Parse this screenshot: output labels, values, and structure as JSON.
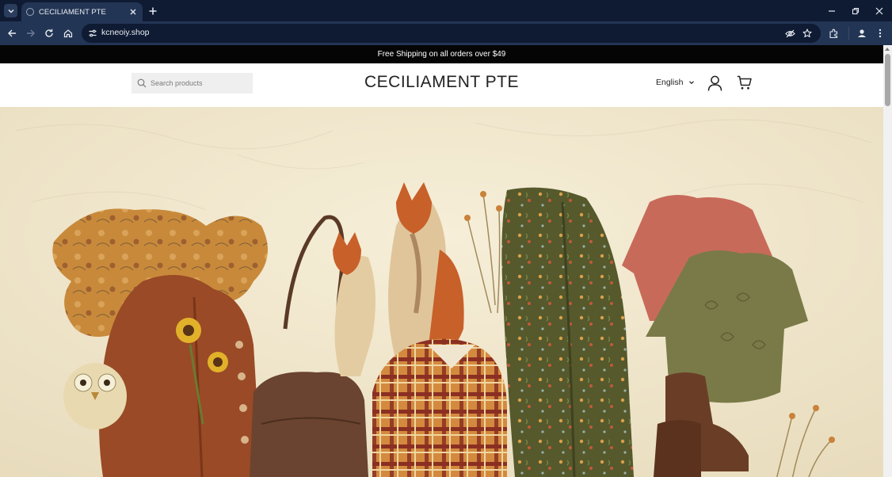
{
  "browser": {
    "tab_title": "CECILIAMENT PTE",
    "url": "kcneoiy.shop",
    "icons": [
      "tab-search-icon",
      "globe-icon",
      "close-icon",
      "plus-icon",
      "minimize-icon",
      "restore-icon",
      "close-window-icon",
      "back-arrow-icon",
      "forward-arrow-icon",
      "reload-icon",
      "home-icon",
      "site-info-icon",
      "eye-off-icon",
      "star-icon",
      "extensions-icon",
      "profile-icon",
      "kebab-menu-icon"
    ]
  },
  "page": {
    "announcement": "Free Shipping on all orders over $49",
    "search_placeholder": "Search products",
    "store_name": "CECILIAMENT PTE",
    "language": "English",
    "icons": [
      "search-icon",
      "chevron-down-icon",
      "account-icon",
      "cart-icon"
    ]
  },
  "hero": {
    "image": "fall-apparel-flatlay",
    "colors": {
      "background": "#f0e7cf",
      "scarf": "#c88a3a",
      "cardigan": "#9a4a26",
      "dress": "#5a5e30",
      "plaid_shirt": "#c87a3a",
      "pink_top": "#c86a5a",
      "olive_top": "#7a7a48",
      "boots": "#6a3e26",
      "bag": "#5a3a26"
    }
  }
}
